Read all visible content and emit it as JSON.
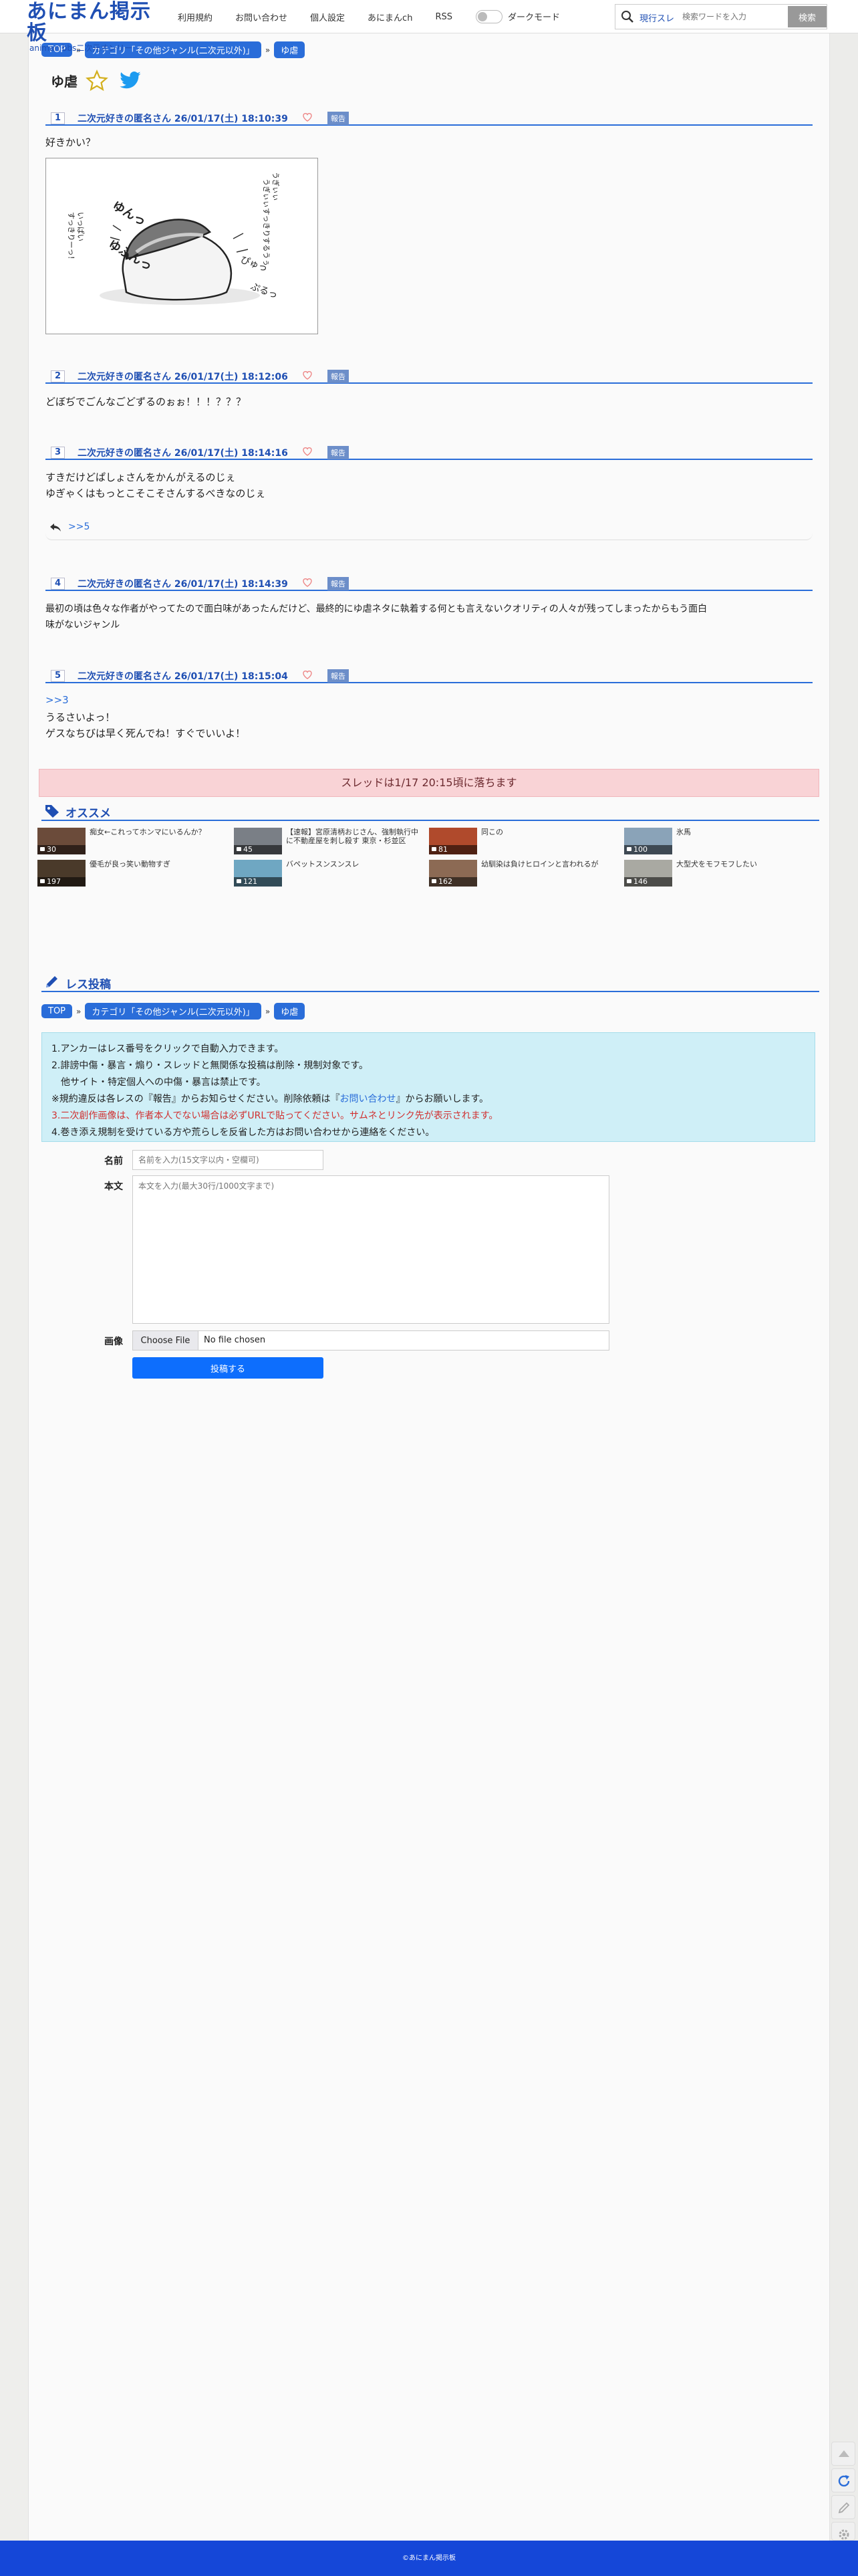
{
  "header": {
    "logo_main": "あにまん掲示板",
    "logo_sub": "animan bbs二次元オンリー",
    "nav": [
      "利用規約",
      "お問い合わせ",
      "個人設定",
      "あにまんch",
      "RSS"
    ],
    "dark_mode_label": "ダークモード",
    "search_scope": "現行スレ",
    "search_placeholder": "検索ワードを入力",
    "search_button": "検索"
  },
  "breadcrumbs": [
    "TOP",
    "カテゴリ「その他ジャンル(二次元以外)」",
    "ゆ虐"
  ],
  "thread_title": "ゆ虐",
  "posts": [
    {
      "no": "1",
      "name": "二次元好きの匿名さん",
      "date": "26/01/17(土) 18:10:39",
      "report": "報告",
      "lines": [
        "好きかい？"
      ]
    },
    {
      "no": "2",
      "name": "二次元好きの匿名さん",
      "date": "26/01/17(土) 18:12:06",
      "report": "報告",
      "lines": [
        "どぼぢでごんなごどずるのぉぉ！！！？？？"
      ]
    },
    {
      "no": "3",
      "name": "二次元好きの匿名さん",
      "date": "26/01/17(土) 18:14:16",
      "report": "報告",
      "lines": [
        "すきだけどぱしょさんをかんがえるのじぇ",
        "ゆぎゃくはもっとこそこそさんするべきなのじぇ"
      ],
      "reply": ">>5"
    },
    {
      "no": "4",
      "name": "二次元好きの匿名さん",
      "date": "26/01/17(土) 18:14:39",
      "report": "報告",
      "lines": [
        "最初の頃は色々な作者がやってたので面白味があったんだけど、最終的にゆ虐ネタに執着する何とも言えないクオリティの人々が残ってしまったからもう面白",
        "味がないジャンル"
      ]
    },
    {
      "no": "5",
      "name": "二次元好きの匿名さん",
      "date": "26/01/17(土) 18:15:04",
      "report": "報告",
      "anchor": ">>3",
      "lines": [
        "うるさいよっ！",
        "ゲスなちびは早く死んでね！すぐでいいよ！"
      ]
    }
  ],
  "image_texts": {
    "left": "いっぱい\nすっきりーっ！",
    "right": "うぎぃぃ\nうぎぃぃすっきりするうぅ",
    "mid1": "ゆんっ",
    "mid2": "ゆふんっ",
    "pyu": "ぴゅっ",
    "puu": "ぷるっ"
  },
  "fall_notice": "スレッドは1/17 20:15頃に落ちます",
  "recommend": {
    "title": "オススメ",
    "items": [
      {
        "title": "痴女←これってホンマにいるんか？",
        "count": "30",
        "color": "#6b4b3a"
      },
      {
        "title": "【速報】宮原清柄おじさん、強制執行中に不動産屋を刺し殺す 東京・杉並区",
        "count": "45",
        "color": "#7a7f86"
      },
      {
        "title": "同この",
        "count": "81",
        "color": "#b04a2c"
      },
      {
        "title": "氷馬",
        "count": "100",
        "color": "#8aa3b8"
      },
      {
        "title": "優毛が良っ笑い動物すぎ",
        "count": "197",
        "color": "#4a3a2a"
      },
      {
        "title": "バペットスンスンスレ",
        "count": "121",
        "color": "#6fa7c2"
      },
      {
        "title": "幼馴染は負けヒロインと言われるが",
        "count": "162",
        "color": "#8c6a54"
      },
      {
        "title": "大型犬をモフモフしたい",
        "count": "146",
        "color": "#a9a9a2"
      }
    ]
  },
  "post_form": {
    "title": "レス投稿",
    "rules": [
      "1.アンカーはレス番号をクリックで自動入力できます。",
      "2.誹謗中傷・暴言・煽り・スレッドと無関係な投稿は削除・規制対象です。",
      "　他サイト・特定個人への中傷・暴言は禁止です。",
      "※規約違反は各レスの『報告』からお知らせください。削除依頼は『",
      "お問い合わせ",
      "』からお願いします。",
      "3.二次創作画像は、",
      "作者本人でない場合は必ずURLで貼ってください。",
      "サムネとリンク先が表示されます。",
      "4.巻き添え規制を受けている方や荒らしを反省した方はお問い合わせから連絡をください。"
    ],
    "name_label": "名前",
    "name_placeholder": "名前を入力(15文字以内・空欄可)",
    "body_label": "本文",
    "body_placeholder": "本文を入力(最大30行/1000文字まで)",
    "image_label": "画像",
    "file_button": "Choose File",
    "file_status": "No file chosen",
    "submit": "投稿する"
  },
  "footer": "©あにまん掲示板"
}
